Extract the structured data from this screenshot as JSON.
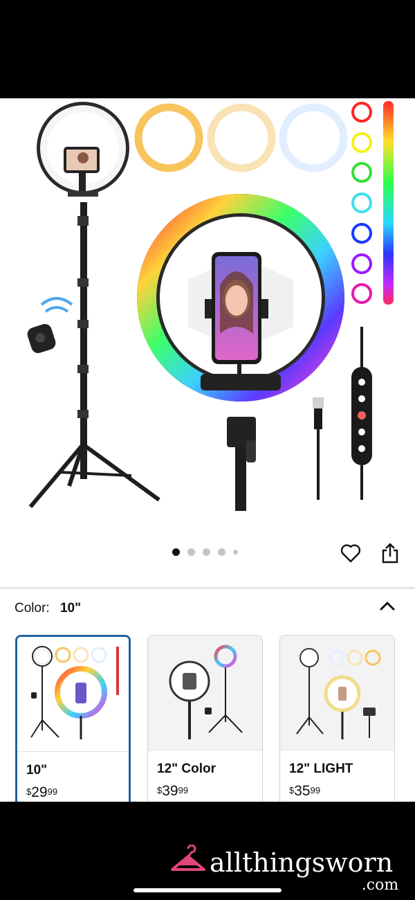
{
  "carousel": {
    "dot_count": 5,
    "active_index": 0
  },
  "variation": {
    "label": "Color:",
    "selected_value": "10\"",
    "options": [
      {
        "name": "10\"",
        "currency": "$",
        "price_whole": "29",
        "price_fraction": "99"
      },
      {
        "name": "12\" Color",
        "currency": "$",
        "price_whole": "39",
        "price_fraction": "99"
      },
      {
        "name": "12\" LIGHT",
        "currency": "$",
        "price_whole": "35",
        "price_fraction": "99"
      }
    ]
  },
  "watermark": {
    "main": "allthingsworn",
    "suffix": ".com"
  },
  "colors": {
    "selected_border": "#2162a1",
    "text": "#0f1111",
    "watermark_pink": "#e0457b"
  }
}
